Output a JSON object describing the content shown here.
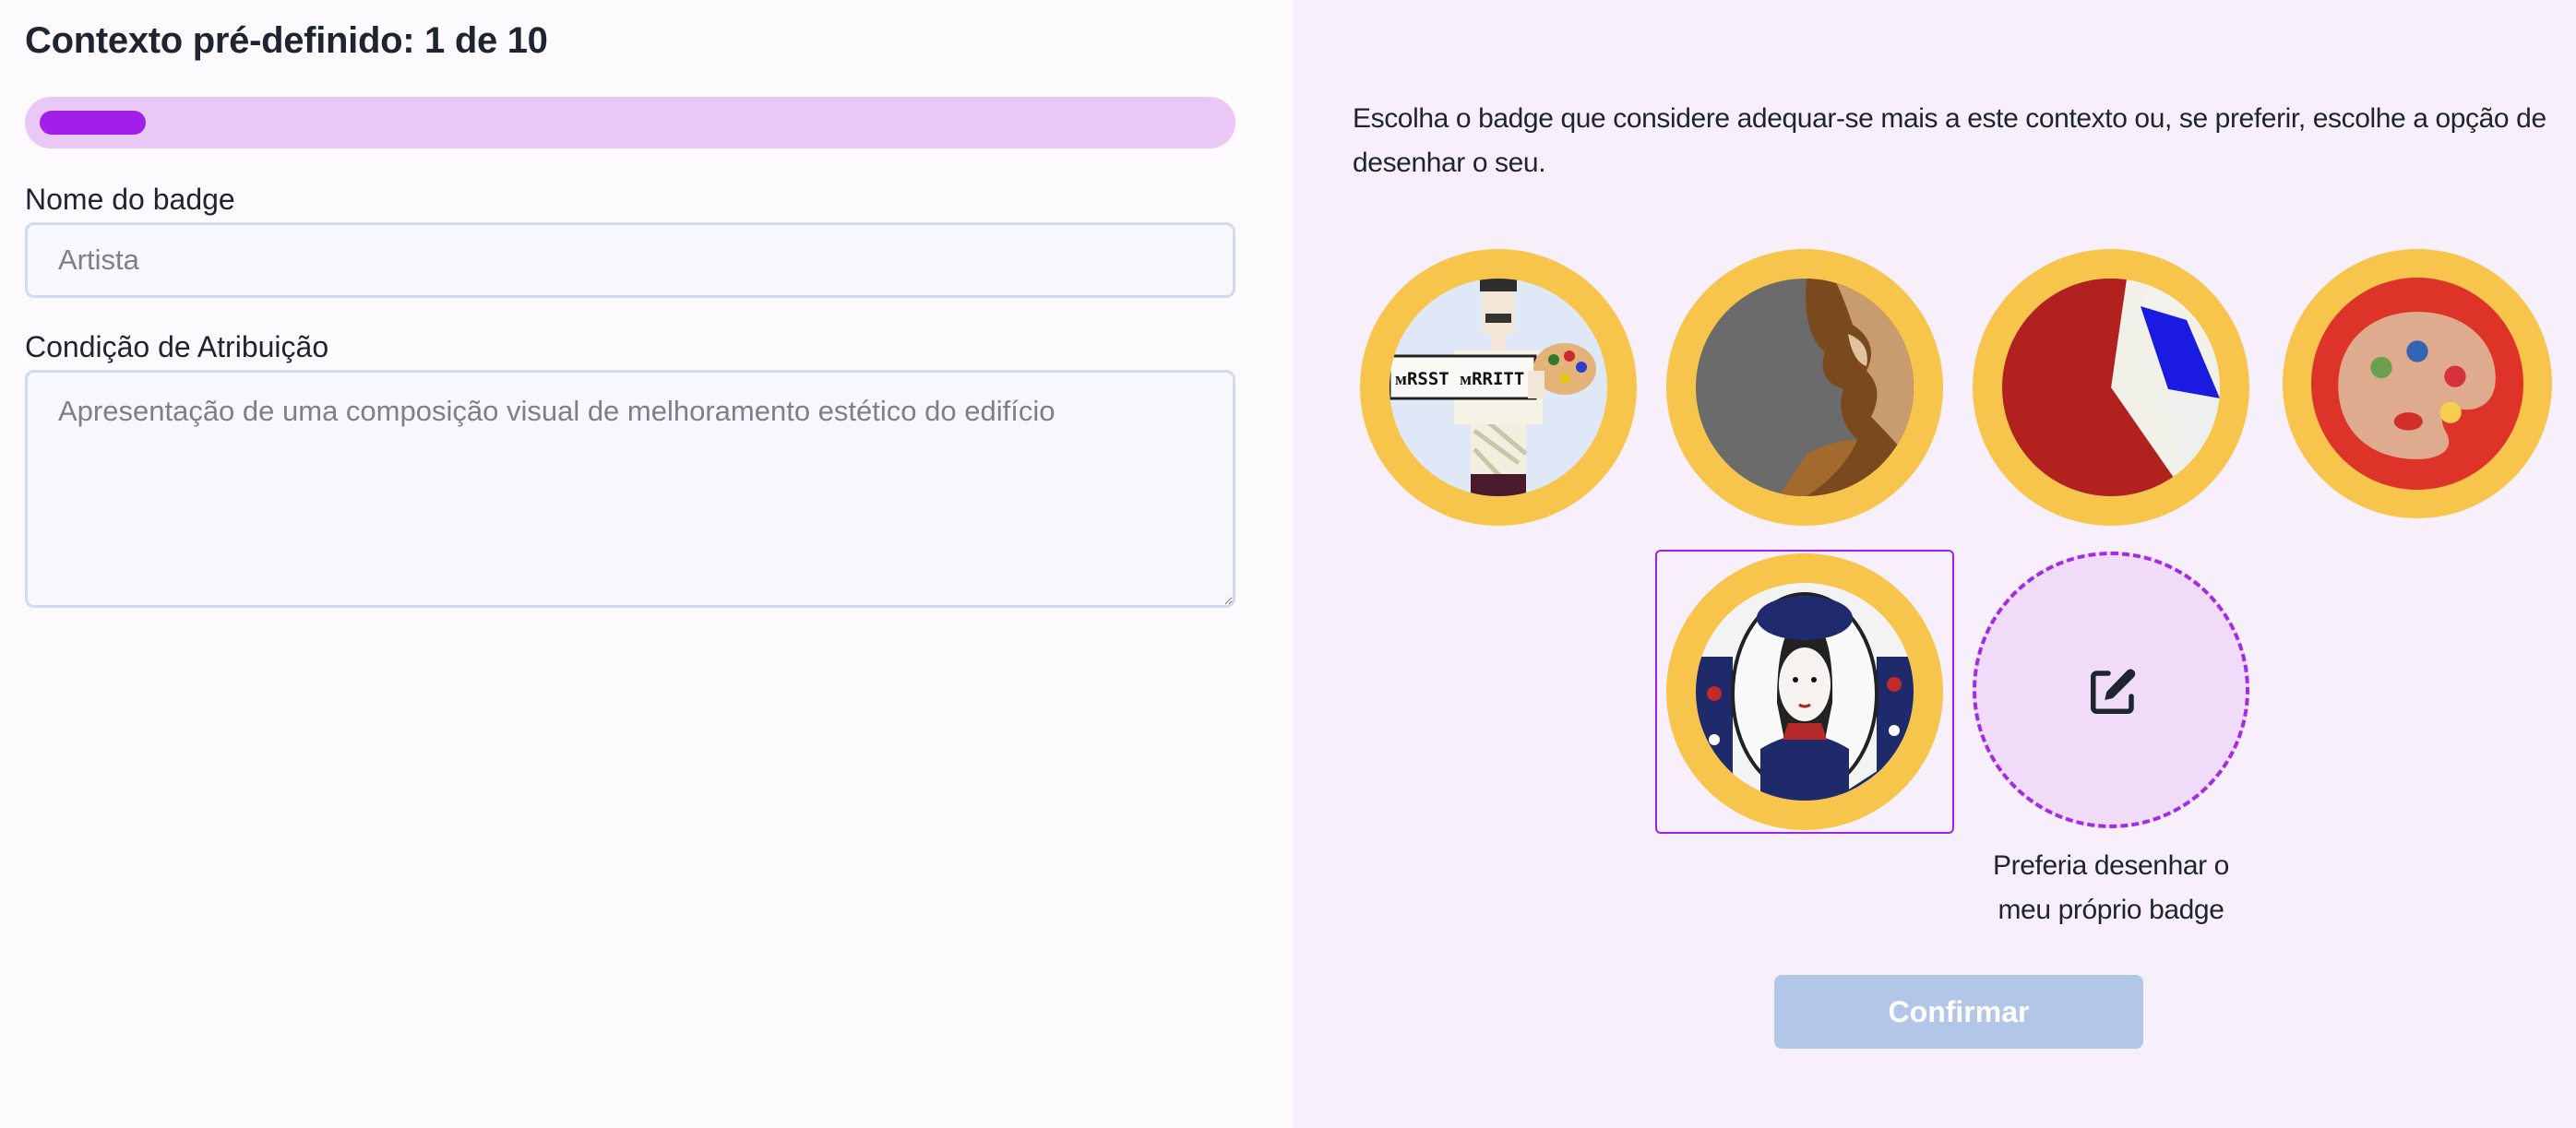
{
  "header": {
    "title": "Contexto pré-definido: 1 de 10"
  },
  "progress": {
    "current": 1,
    "total": 10
  },
  "form": {
    "name_label": "Nome do badge",
    "name_placeholder": "Artista",
    "condition_label": "Condição de Atribuição",
    "condition_placeholder": "Apresentação de uma composição visual de melhoramento estético do edifício"
  },
  "chooser": {
    "instructions": "Escolha o badge que considere adequar-se mais a este contexto ou, se preferir, escolhe a opção de desenhar o seu.",
    "badges": [
      {
        "icon": "pixel-artist-icon",
        "selected": false
      },
      {
        "icon": "abstract-face-icon",
        "selected": false
      },
      {
        "icon": "color-slice-icon",
        "selected": false
      },
      {
        "icon": "paint-palette-icon",
        "selected": false
      },
      {
        "icon": "beret-portrait-icon",
        "selected": true
      }
    ],
    "draw_own": {
      "icon": "edit-icon",
      "label": "Preferia desenhar o meu próprio badge"
    },
    "confirm_label": "Confirmar"
  },
  "colors": {
    "accent": "#a11fe8",
    "progress_track": "#e9c8f8",
    "badge_ring": "#f7c44c",
    "confirm_disabled": "#b2c6e8",
    "right_panel_bg": "#f7f0fa"
  }
}
